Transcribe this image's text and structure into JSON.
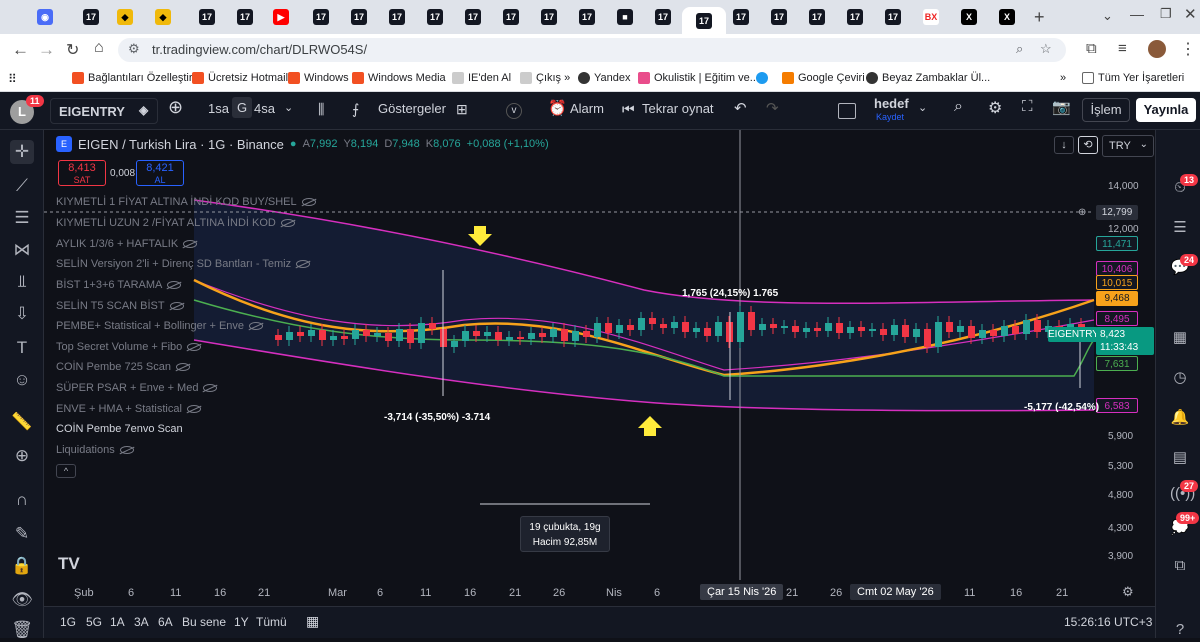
{
  "browser": {
    "url": "tr.tradingview.com/chart/DLRWO54S/",
    "bookmarks": [
      "Bağlantıları Özelleştir",
      "Ücretsiz Hotmail",
      "Windows",
      "Windows Media",
      "IE'den Al",
      "Çıkış »",
      "Yandex",
      "Okulistik | Eğitim ve...",
      "Google Çeviri",
      "Beyaz Zambaklar Ül...",
      "Tüm Yer İşaretleri"
    ]
  },
  "toolbar": {
    "avatar_letter": "L",
    "avatar_badge": "11",
    "symbol": "EIGENTRY",
    "interval_1": "1sa",
    "interval_2": "G",
    "interval_3": "4sa",
    "indicators": "Göstergeler",
    "alarm": "Alarm",
    "replay": "Tekrar oynat",
    "layout_name": "hedef",
    "layout_save": "Kaydet",
    "trade": "İşlem",
    "publish": "Yayınla"
  },
  "legend": {
    "title": "EIGEN / Turkish Lira · 1G · Binance",
    "o_label": "A",
    "o": "7,992",
    "h_label": "Y",
    "h": "8,194",
    "l_label": "D",
    "l": "7,948",
    "c_label": "K",
    "c": "8,076",
    "change": "+0,088 (+1,10%)",
    "sell_price": "8,413",
    "sell_label": "SAT",
    "spread": "0,008",
    "buy_price": "8,421",
    "buy_label": "AL",
    "currency": "TRY"
  },
  "indicators": [
    "KIYMETLİ 1 FİYAT ALTINA İNDİ KOD BUY/SHEL",
    "KIYMETLİ UZUN 2 /FİYAT ALTINA İNDİ KOD",
    "AYLIK 1/3/6 + HAFTALIK",
    "SELİN Versiyon 2'li + Direnç SD Bantları - Temiz",
    "BİST 1+3+6 TARAMA",
    "SELİN T5 SCAN BİST",
    "PEMBE+ Statistical + Bollinger + Enve",
    "Top Secret Volume + Fibo",
    "COİN Pembe 725 Scan",
    "SÜPER PSAR + Enve + Med",
    "ENVE + HMA + Statistical",
    "COİN Pembe 7envo Scan",
    "Liquidations"
  ],
  "chart_data": {
    "type": "candlestick",
    "price_scale": [
      "14,000",
      "12,000",
      "10,406",
      "10,015",
      "9,468",
      "8,495",
      "7,631",
      "6,583",
      "5,900",
      "5,300",
      "4,800",
      "4,300",
      "3,900"
    ],
    "x_ticks": [
      "Şub",
      "6",
      "11",
      "16",
      "21",
      "Mar",
      "6",
      "11",
      "16",
      "21",
      "26",
      "Nis",
      "6",
      "21",
      "26",
      "11",
      "16",
      "21"
    ],
    "crosshair_price": "12,799",
    "last_price": "8,423",
    "last_label": "EIGENTRY",
    "countdown": "11:33:43",
    "level_labels": {
      "l11471": "11,471",
      "l10406": "10,406",
      "l10015": "10,015",
      "l9468": "9,468",
      "l8495": "8,495",
      "l7631": "7,631",
      "l6583": "6,583"
    },
    "measure_1": "-3,714 (-35,50%) -3.714",
    "measure_2": "1,765 (24,15%) 1.765",
    "measure_3": "-5,177 (-42,54%)",
    "range_box_line1": "19 çubukta, 19g",
    "range_box_line2": "Hacim 92,85M",
    "date_cursor": "Çar 15 Nis '26",
    "date_cursor_2": "Cmt 02 May '26"
  },
  "bottom": {
    "ranges": [
      "1G",
      "5G",
      "1A",
      "3A",
      "6A",
      "Bu sene",
      "1Y",
      "Tümü"
    ],
    "clock": "15:26:16 UTC+3"
  },
  "colors": {
    "up": "#26a69a",
    "down": "#f23645",
    "ma_orange": "#f7a21b",
    "band_pink": "#d62fbf",
    "green_line": "#4caf50"
  }
}
